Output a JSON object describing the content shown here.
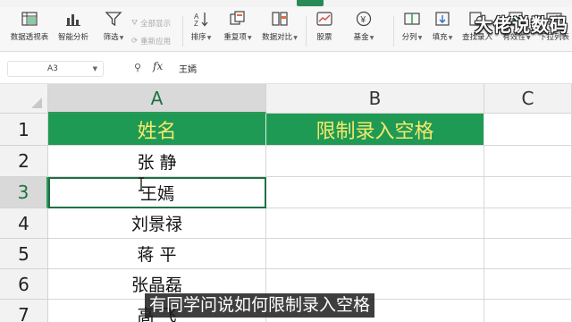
{
  "ribbon": {
    "buttons": [
      {
        "id": "pivot",
        "label": "数据透视表",
        "icon": "pivot-table-icon"
      },
      {
        "id": "smart",
        "label": "智能分析",
        "icon": "smart-analysis-icon"
      },
      {
        "id": "filter",
        "label": "筛选",
        "icon": "filter-icon"
      },
      {
        "id": "sort",
        "label": "排序",
        "icon": "sort-icon"
      },
      {
        "id": "dup",
        "label": "重复项",
        "icon": "duplicates-icon"
      },
      {
        "id": "compare",
        "label": "数据对比",
        "icon": "data-compare-icon"
      },
      {
        "id": "stock",
        "label": "股票",
        "icon": "stock-icon"
      },
      {
        "id": "fund",
        "label": "基金",
        "icon": "fund-icon"
      },
      {
        "id": "split",
        "label": "分列",
        "icon": "split-columns-icon"
      },
      {
        "id": "fill",
        "label": "填充",
        "icon": "fill-icon"
      },
      {
        "id": "lookup",
        "label": "查找录入",
        "icon": "lookup-entry-icon"
      },
      {
        "id": "validity",
        "label": "有效性",
        "icon": "validation-icon"
      },
      {
        "id": "dropdown",
        "label": "下拉列表",
        "icon": "dropdown-list-icon"
      }
    ],
    "show_all_label": "全部显示",
    "reapply_label": "重新应用",
    "watermark": "大佬说数码"
  },
  "formula_bar": {
    "name_box": "A3",
    "fx_label": "fx",
    "content": "王嫣"
  },
  "columns": [
    "A",
    "B",
    "C"
  ],
  "rows": [
    "1",
    "2",
    "3",
    "4",
    "5",
    "6",
    "7"
  ],
  "selected_row": "3",
  "selected_column": "A",
  "table": {
    "header_a": "姓名",
    "header_b": "限制录入空格",
    "names": [
      "张 静",
      "王嫣",
      "刘景禄",
      "蒋 平",
      "张晶磊",
      "高 飞"
    ]
  },
  "subtitle": "有同学问说如何限制录入空格",
  "colors": {
    "header_fill": "#1f9a55",
    "header_text": "#f6e96a",
    "selection": "#1e7145"
  }
}
